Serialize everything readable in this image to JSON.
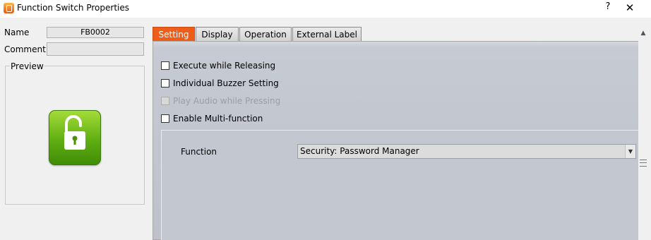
{
  "window": {
    "title": "Function Switch Properties",
    "help_label": "?",
    "close_label": "✕"
  },
  "left": {
    "name_label": "Name",
    "name_value": "FB0002",
    "comment_label": "Comment",
    "comment_value": "",
    "preview_label": "Preview",
    "preview_icon": "unlock-icon"
  },
  "tabs": [
    {
      "label": "Setting",
      "active": true
    },
    {
      "label": "Display",
      "active": false
    },
    {
      "label": "Operation",
      "active": false
    },
    {
      "label": "External Label",
      "active": false
    }
  ],
  "settings": {
    "options": [
      {
        "label": "Execute while Releasing",
        "checked": false,
        "enabled": true
      },
      {
        "label": "Individual Buzzer Setting",
        "checked": false,
        "enabled": true
      },
      {
        "label": "Play Audio while Pressing",
        "checked": false,
        "enabled": false
      },
      {
        "label": "Enable Multi-function",
        "checked": false,
        "enabled": true
      }
    ],
    "function_label": "Function",
    "function_value": "Security: Password Manager"
  },
  "colors": {
    "active_tab": "#ee5e1a",
    "preview_button": "#5fae12"
  }
}
